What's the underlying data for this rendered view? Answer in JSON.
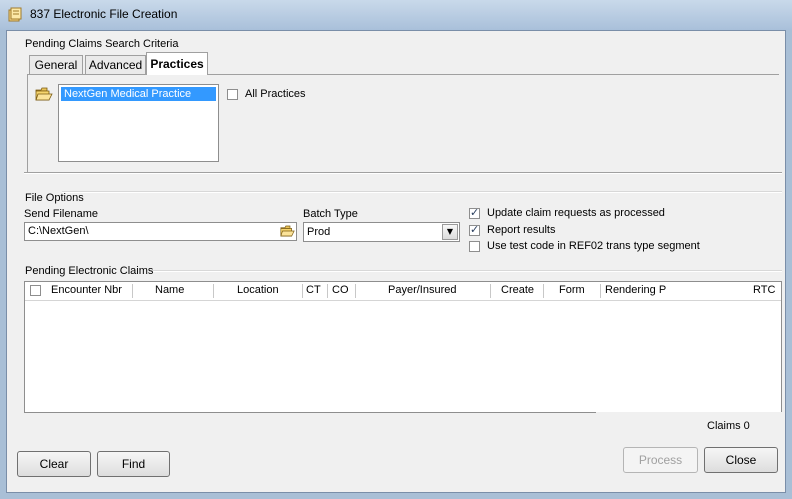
{
  "window": {
    "title": "837 Electronic File Creation"
  },
  "search_criteria": {
    "label": "Pending Claims Search Criteria",
    "tabs": [
      {
        "label": "General",
        "active": false
      },
      {
        "label": "Advanced",
        "active": false
      },
      {
        "label": "Practices",
        "active": true
      }
    ],
    "practices_list": [
      "NextGen Medical Practice"
    ],
    "all_practices": {
      "label": "All Practices",
      "checked": false
    }
  },
  "file_options": {
    "label": "File Options",
    "send_filename": {
      "label": "Send Filename",
      "value": "C:\\NextGen\\"
    },
    "batch_type": {
      "label": "Batch Type",
      "value": "Prod"
    },
    "update_claims": {
      "label": "Update claim requests as processed",
      "checked": true
    },
    "report_results": {
      "label": "Report results",
      "checked": true
    },
    "use_test_code": {
      "label": "Use test code in REF02 trans type segment",
      "checked": false
    }
  },
  "pending_claims": {
    "label": "Pending Electronic Claims",
    "columns": [
      "Encounter Nbr",
      "Name",
      "Location",
      "CT",
      "CO",
      "Payer/Insured",
      "Create",
      "Form",
      "Rendering P",
      "RTC"
    ],
    "claims_count": "Claims 0"
  },
  "buttons": {
    "clear": "Clear",
    "find": "Find",
    "process": "Process",
    "close": "Close"
  }
}
